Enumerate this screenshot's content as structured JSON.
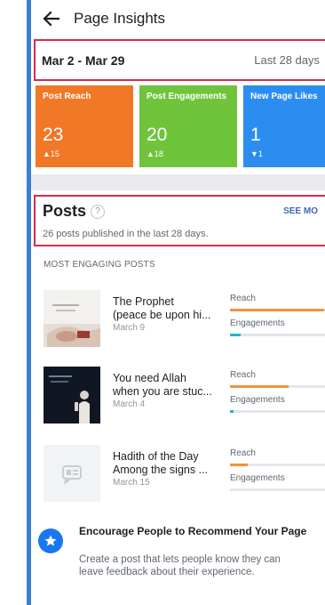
{
  "header": {
    "title": "Page Insights"
  },
  "date_bar": {
    "range": "Mar 2 - Mar 29",
    "period": "Last 28 days"
  },
  "cards": [
    {
      "title": "Post Reach",
      "value": "23",
      "delta": "▲15",
      "color": "#f07826"
    },
    {
      "title": "Post Engagements",
      "value": "20",
      "delta": "▲18",
      "color": "#6fc43b"
    },
    {
      "title": "New Page Likes",
      "value": "1",
      "delta": "▼1",
      "color": "#2c8df0"
    }
  ],
  "posts": {
    "title": "Posts",
    "help": "?",
    "see_more": "SEE MO",
    "subtitle": "26 posts published in the last 28 days."
  },
  "most_engaging": {
    "label": "MOST ENGAGING POSTS",
    "items": [
      {
        "title_line1": "The Prophet",
        "title_line2": "(peace be upon hi...",
        "date": "March 9",
        "reach_label": "Reach",
        "engagement_label": "Engagements",
        "reach_level": 0.88,
        "engagement_level": 0.1
      },
      {
        "title_line1": "You need Allah",
        "title_line2": "when you are stuc...",
        "date": "March 4",
        "reach_label": "Reach",
        "engagement_label": "Engagements",
        "reach_level": 0.55,
        "engagement_level": 0.03
      },
      {
        "title_line1": "Hadith of the Day",
        "title_line2": "Among the signs ...",
        "date": "March 15",
        "reach_label": "Reach",
        "engagement_label": "Engagements",
        "reach_level": 0.17,
        "engagement_level": 0
      }
    ]
  },
  "recommend": {
    "title": "Encourage People to Recommend Your Page",
    "body": "Create a post that lets people know they can leave feedback about their experience."
  },
  "colors": {
    "accent": "#1877f2",
    "highlight_border": "#d32f4b",
    "reach_bar": "#f7923a",
    "engagement_bar": "#22b4c6"
  }
}
